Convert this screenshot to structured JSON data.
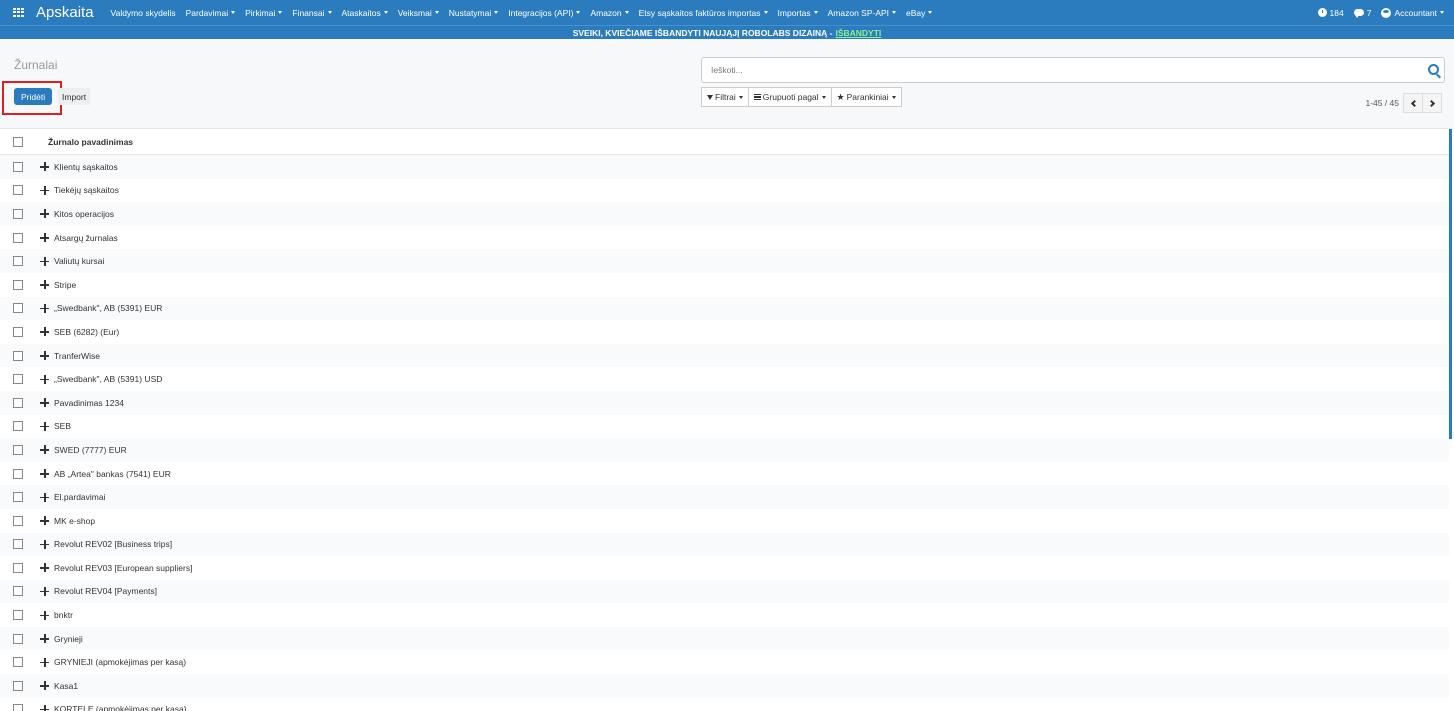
{
  "app": {
    "title": "Apskaita"
  },
  "menu": [
    {
      "label": "Valdymo skydelis",
      "dropdown": false
    },
    {
      "label": "Pardavimai",
      "dropdown": true
    },
    {
      "label": "Pirkimai",
      "dropdown": true
    },
    {
      "label": "Finansai",
      "dropdown": true
    },
    {
      "label": "Ataskaitos",
      "dropdown": true
    },
    {
      "label": "Veiksmai",
      "dropdown": true
    },
    {
      "label": "Nustatymai",
      "dropdown": true
    },
    {
      "label": "Integracijos (API)",
      "dropdown": true
    },
    {
      "label": "Amazon",
      "dropdown": true
    },
    {
      "label": "Etsy sąskaitos faktūros importas",
      "dropdown": true
    },
    {
      "label": "Importas",
      "dropdown": true
    },
    {
      "label": "Amazon SP-API",
      "dropdown": true
    },
    {
      "label": "eBay",
      "dropdown": true
    }
  ],
  "topright": {
    "activities_count": "184",
    "messages_count": "7",
    "user": "Accountant"
  },
  "banner": {
    "text": "SVEIKI, KVIEČIAME IŠBANDYTI NAUJĄJĮ ROBOLABS DIZAINĄ -",
    "link": "IŠBANDYTI"
  },
  "control": {
    "title": "Žurnalai",
    "add_label": "Pridėti",
    "import_label": "Import",
    "search_placeholder": "Ieškoti...",
    "filters_label": "Filtrai",
    "group_label": "Grupuoti pagal",
    "favorites_label": "Parankiniai",
    "pager_value": "1-45 / 45"
  },
  "table": {
    "header": "Žurnalo pavadinimas",
    "rows": [
      "Klientų sąskaitos",
      "Tiekėjų sąskaitos",
      "Kitos operacijos",
      "Atsargų žurnalas",
      "Valiutų kursai",
      "Stripe",
      "„Swedbank\", AB (5391) EUR",
      "SEB (6282) (Eur)",
      "TranferWise",
      "„Swedbank\", AB (5391) USD",
      "Pavadinimas 1234",
      "SEB",
      "SWED (7777) EUR",
      "AB „Artea\" bankas (7541) EUR",
      "El.pardavimai",
      "MK e-shop",
      "Revolut REV02 [Business trips]",
      "Revolut REV03 [European suppliers]",
      "Revolut REV04 [Payments]",
      "bnktr",
      "Grynieji",
      "GRYNIEJI (apmokėjimas per kasą)",
      "Kasa1",
      "KORTELE (apmokėjimas per kasą)"
    ]
  },
  "colors": {
    "primary": "#2b7bbf",
    "highlight": "#e02020",
    "banner_link": "#8fef8f"
  },
  "icons": [
    "apps-icon",
    "clock-icon",
    "chat-icon",
    "avatar",
    "search-icon",
    "funnel-icon",
    "bars-icon",
    "star-icon",
    "chevron-left-icon",
    "chevron-right-icon",
    "move-icon"
  ]
}
